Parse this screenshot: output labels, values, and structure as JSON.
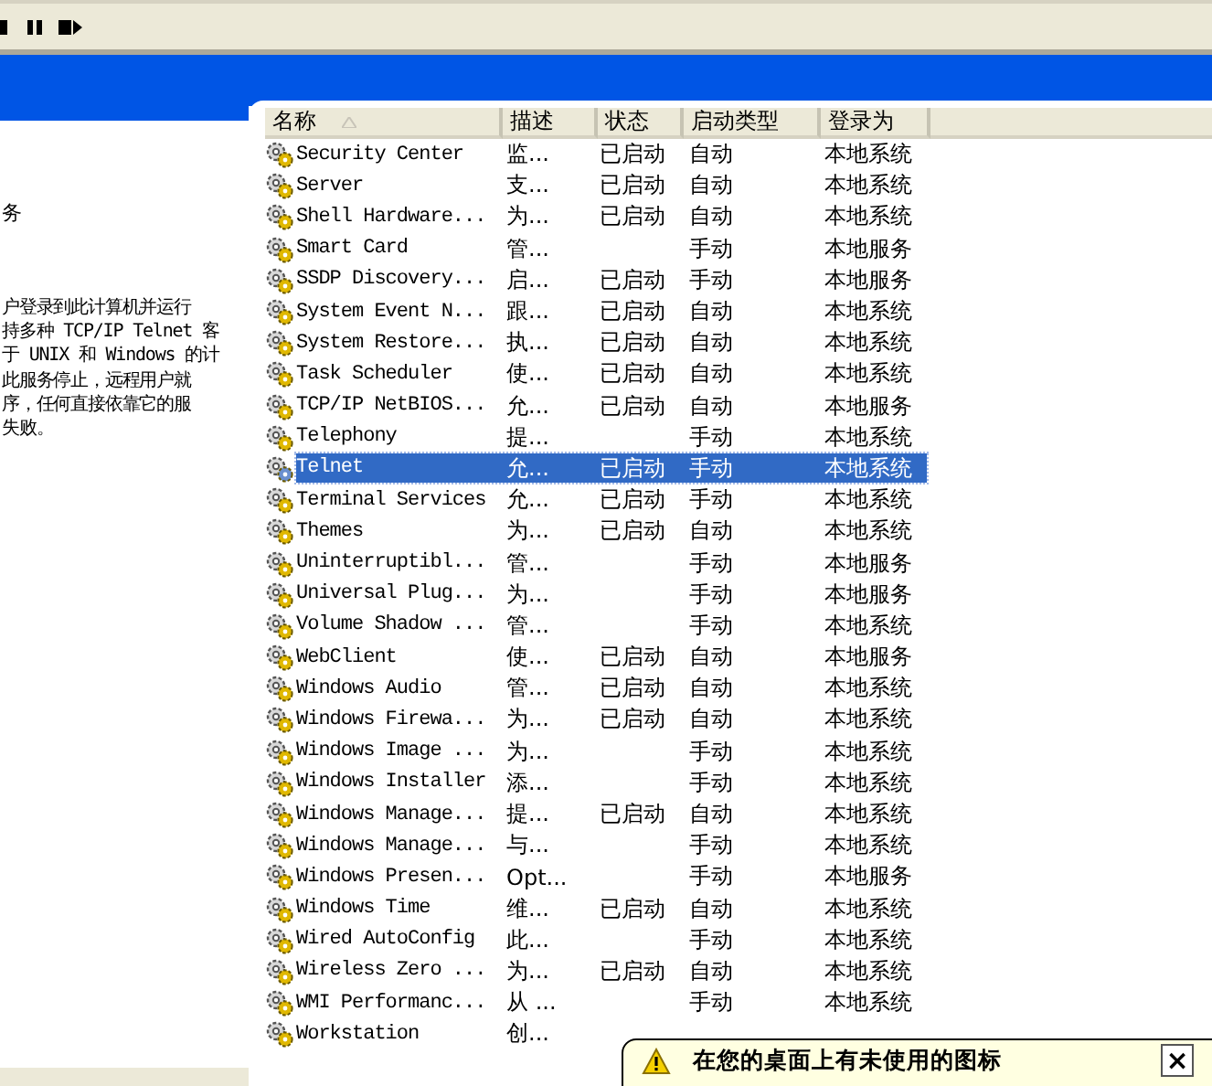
{
  "toolbar": {
    "buttons": [
      {
        "kind": "stop"
      },
      {
        "kind": "pause"
      },
      {
        "kind": "restart"
      }
    ]
  },
  "description": {
    "heading": "务",
    "lines": [
      "户登录到此计算机并运行",
      "持多种 TCP/IP Telnet 客",
      "于 UNIX 和 Windows 的计",
      "此服务停止，远程用户就",
      "序，任何直接依靠它的服",
      "失败。"
    ]
  },
  "table": {
    "columns": [
      {
        "label": "名称",
        "sorted": true
      },
      {
        "label": "描述"
      },
      {
        "label": "状态"
      },
      {
        "label": "启动类型"
      },
      {
        "label": "登录为"
      }
    ],
    "rows": [
      {
        "name": "Security Center",
        "description": "监...",
        "status": "已启动",
        "startup": "自动",
        "logon": "本地系统",
        "selected": false
      },
      {
        "name": "Server",
        "description": "支...",
        "status": "已启动",
        "startup": "自动",
        "logon": "本地系统",
        "selected": false
      },
      {
        "name": "Shell Hardware...",
        "description": "为...",
        "status": "已启动",
        "startup": "自动",
        "logon": "本地系统",
        "selected": false
      },
      {
        "name": "Smart Card",
        "description": "管...",
        "status": "",
        "startup": "手动",
        "logon": "本地服务",
        "selected": false
      },
      {
        "name": "SSDP Discovery...",
        "description": "启...",
        "status": "已启动",
        "startup": "手动",
        "logon": "本地服务",
        "selected": false
      },
      {
        "name": "System Event N...",
        "description": "跟...",
        "status": "已启动",
        "startup": "自动",
        "logon": "本地系统",
        "selected": false
      },
      {
        "name": "System Restore...",
        "description": "执...",
        "status": "已启动",
        "startup": "自动",
        "logon": "本地系统",
        "selected": false
      },
      {
        "name": "Task Scheduler",
        "description": "使...",
        "status": "已启动",
        "startup": "自动",
        "logon": "本地系统",
        "selected": false
      },
      {
        "name": "TCP/IP NetBIOS...",
        "description": "允...",
        "status": "已启动",
        "startup": "自动",
        "logon": "本地服务",
        "selected": false
      },
      {
        "name": "Telephony",
        "description": "提...",
        "status": "",
        "startup": "手动",
        "logon": "本地系统",
        "selected": false
      },
      {
        "name": "Telnet",
        "description": "允...",
        "status": "已启动",
        "startup": "手动",
        "logon": "本地系统",
        "selected": true
      },
      {
        "name": "Terminal Services",
        "description": "允...",
        "status": "已启动",
        "startup": "手动",
        "logon": "本地系统",
        "selected": false
      },
      {
        "name": "Themes",
        "description": "为...",
        "status": "已启动",
        "startup": "自动",
        "logon": "本地系统",
        "selected": false
      },
      {
        "name": "Uninterruptibl...",
        "description": "管...",
        "status": "",
        "startup": "手动",
        "logon": "本地服务",
        "selected": false
      },
      {
        "name": "Universal Plug...",
        "description": "为...",
        "status": "",
        "startup": "手动",
        "logon": "本地服务",
        "selected": false
      },
      {
        "name": "Volume Shadow ...",
        "description": "管...",
        "status": "",
        "startup": "手动",
        "logon": "本地系统",
        "selected": false
      },
      {
        "name": "WebClient",
        "description": "使...",
        "status": "已启动",
        "startup": "自动",
        "logon": "本地服务",
        "selected": false
      },
      {
        "name": "Windows Audio",
        "description": "管...",
        "status": "已启动",
        "startup": "自动",
        "logon": "本地系统",
        "selected": false
      },
      {
        "name": "Windows Firewa...",
        "description": "为...",
        "status": "已启动",
        "startup": "自动",
        "logon": "本地系统",
        "selected": false
      },
      {
        "name": "Windows Image ...",
        "description": "为...",
        "status": "",
        "startup": "手动",
        "logon": "本地系统",
        "selected": false
      },
      {
        "name": "Windows Installer",
        "description": "添...",
        "status": "",
        "startup": "手动",
        "logon": "本地系统",
        "selected": false
      },
      {
        "name": "Windows Manage...",
        "description": "提...",
        "status": "已启动",
        "startup": "自动",
        "logon": "本地系统",
        "selected": false
      },
      {
        "name": "Windows Manage...",
        "description": "与...",
        "status": "",
        "startup": "手动",
        "logon": "本地系统",
        "selected": false
      },
      {
        "name": "Windows Presen...",
        "description": "Opt...",
        "status": "",
        "startup": "手动",
        "logon": "本地服务",
        "selected": false
      },
      {
        "name": "Windows Time",
        "description": "维...",
        "status": "已启动",
        "startup": "自动",
        "logon": "本地系统",
        "selected": false
      },
      {
        "name": "Wired AutoConfig",
        "description": "此...",
        "status": "",
        "startup": "手动",
        "logon": "本地系统",
        "selected": false
      },
      {
        "name": "Wireless Zero ...",
        "description": "为...",
        "status": "已启动",
        "startup": "自动",
        "logon": "本地系统",
        "selected": false
      },
      {
        "name": "WMI Performanc...",
        "description": "从 ...",
        "status": "",
        "startup": "手动",
        "logon": "本地系统",
        "selected": false
      },
      {
        "name": "Workstation",
        "description": "创...",
        "status": "",
        "startup": "",
        "logon": "",
        "selected": false
      }
    ]
  },
  "balloon": {
    "message": "在您的桌面上有未使用的图标",
    "close": "×"
  }
}
